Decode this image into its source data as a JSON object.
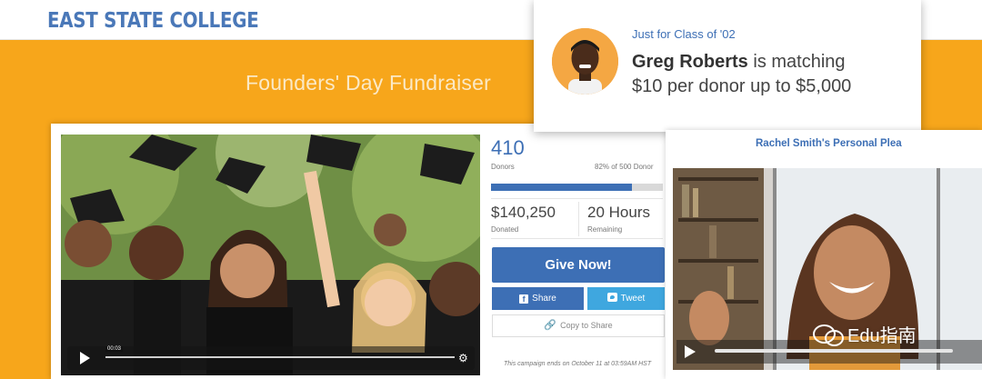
{
  "header": {
    "logo_text": "EAST STATE COLLEGE"
  },
  "banner": {
    "title": "Founders' Day Fundraiser"
  },
  "video": {
    "timestamp": "00:03",
    "icons": [
      "play-icon",
      "gear-icon"
    ]
  },
  "stats": {
    "donors_count": "410",
    "donors_label": "Donors",
    "donors_goal": "82% of 500 Donor",
    "progress_fraction": 0.82,
    "amount": "$140,250",
    "amount_label": "Donated",
    "hours": "20 Hours",
    "hours_label": "Remaining"
  },
  "actions": {
    "give_label": "Give Now!",
    "share_label": "Share",
    "tweet_label": "Tweet",
    "copy_label": "Copy to Share"
  },
  "ends_note": "This campaign ends on October 11 at 03:59AM HST",
  "match": {
    "class_label": "Just for Class of '02",
    "name": "Greg Roberts",
    "line1_rest": " is matching",
    "line2": "$10 per donor up to $5,000"
  },
  "plea": {
    "title": "Rachel Smith's Personal Plea"
  },
  "watermark": {
    "text": "Edu指南"
  },
  "colors": {
    "brand_blue": "#3d6fb5",
    "banner_orange": "#f7a61b",
    "tweet_blue": "#3fa7df"
  }
}
